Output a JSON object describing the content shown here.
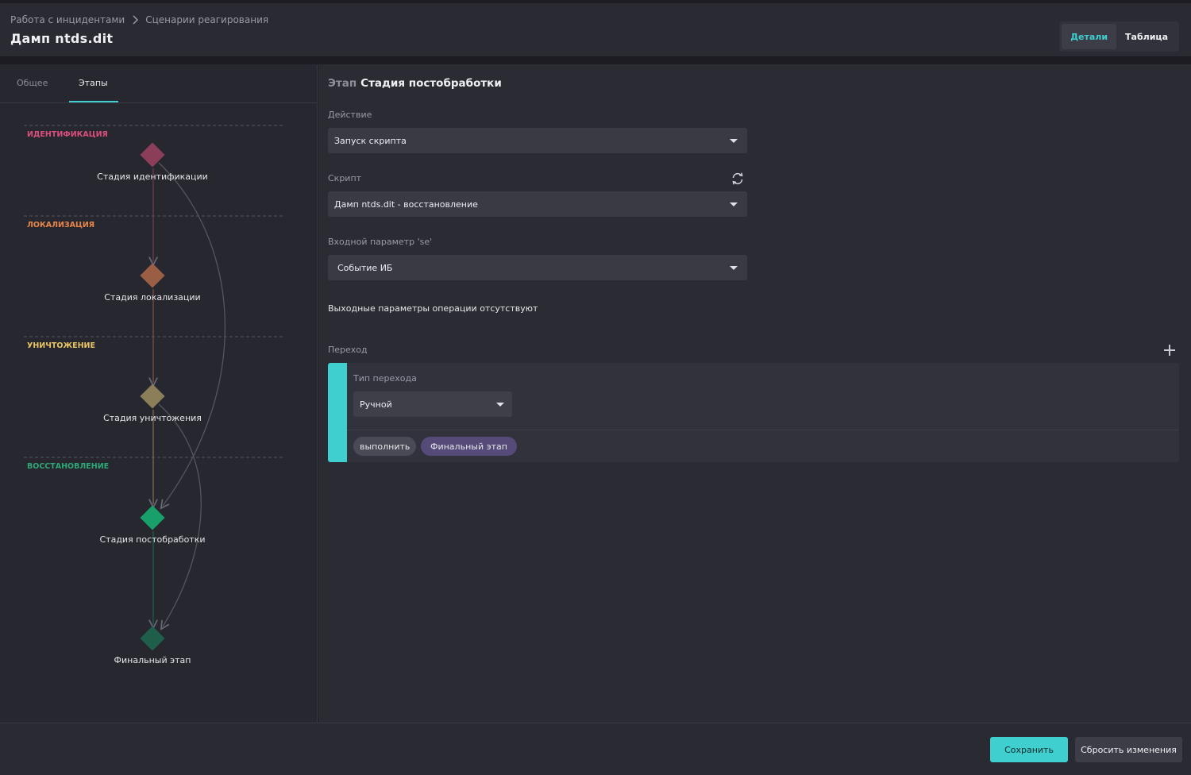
{
  "header": {
    "breadcrumb": [
      "Работа с инцидентами",
      "Сценарии реагирования"
    ],
    "title": "Дамп ntds.dit",
    "view_toggle": {
      "details": "Детали",
      "table": "Таблица",
      "active": "details"
    }
  },
  "left_panel": {
    "tabs": [
      "Общее",
      "Этапы"
    ],
    "active_tab": "Этапы",
    "phases": [
      {
        "label": "ИДЕНТИФИКАЦИЯ",
        "color": "#d94f7a"
      },
      {
        "label": "ЛОКАЛИЗАЦИЯ",
        "color": "#e8864a"
      },
      {
        "label": "УНИЧТОЖЕНИЕ",
        "color": "#e8c462"
      },
      {
        "label": "ВОССТАНОВЛЕНИЕ",
        "color": "#2ea876"
      }
    ],
    "nodes": [
      {
        "label": "Стадия идентификации",
        "color": "#8a3e58"
      },
      {
        "label": "Стадия локализации",
        "color": "#9a5e45"
      },
      {
        "label": "Стадия уничтожения",
        "color": "#8c7e58"
      },
      {
        "label": "Стадия постобработки",
        "color": "#17a06a"
      },
      {
        "label": "Финальный этап",
        "color": "#1f5e4a"
      }
    ]
  },
  "stage": {
    "prefix": "Этап",
    "name": "Стадия постобработки",
    "action": {
      "label": "Действие",
      "value": "Запуск скрипта"
    },
    "script": {
      "label": "Скрипт",
      "value": "Дамп ntds.dit - восстановление",
      "refresh_icon": "refresh-icon"
    },
    "input_param": {
      "label": "Входной параметр 'se'",
      "value": "Событие ИБ"
    },
    "output_note": "Выходные параметры операции отсутствуют",
    "transition": {
      "label": "Переход",
      "type_label": "Тип перехода",
      "type_value": "Ручной",
      "chip_action": "выполнить",
      "chip_target": "Финальный этап",
      "accent": "#3fcfcf"
    }
  },
  "footer": {
    "save": "Сохранить",
    "reset": "Сбросить изменения"
  }
}
